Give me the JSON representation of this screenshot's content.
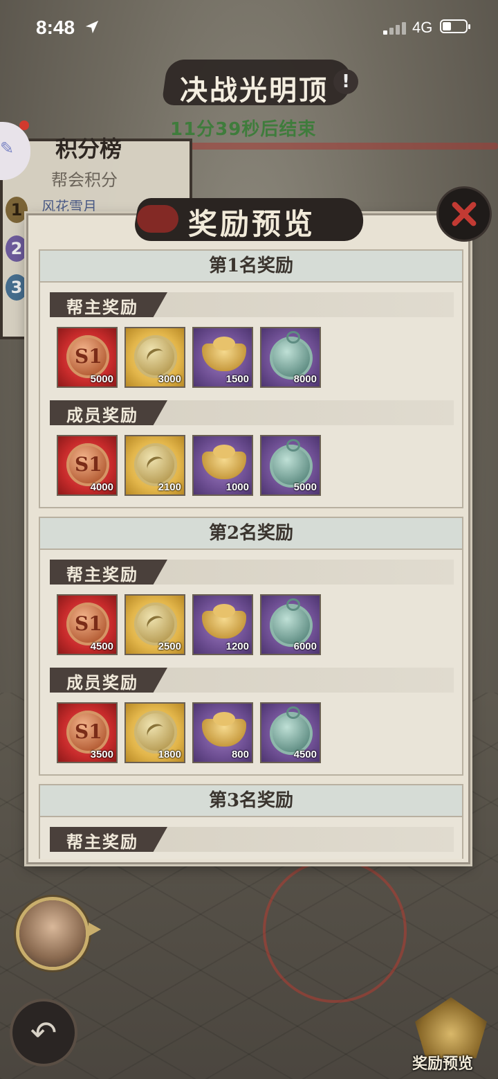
{
  "status_bar": {
    "time": "8:48",
    "network": "4G"
  },
  "event": {
    "title": "决战光明顶",
    "countdown": "11分39秒后结束",
    "alert_symbol": "!"
  },
  "leaderboard": {
    "title": "积分榜",
    "subtitle": "帮会积分",
    "first_name": "风花雪月",
    "ranks": [
      "1",
      "2",
      "3"
    ]
  },
  "modal": {
    "title": "奖励预览",
    "ranks": [
      {
        "heading": "第1名奖励",
        "groups": [
          {
            "label": "帮主奖励",
            "items": [
              {
                "kind": "s1-coin",
                "quantity": "5000"
              },
              {
                "kind": "feather-coin",
                "quantity": "3000"
              },
              {
                "kind": "gold-ingot",
                "quantity": "1500"
              },
              {
                "kind": "jade-medal",
                "quantity": "8000"
              }
            ]
          },
          {
            "label": "成员奖励",
            "items": [
              {
                "kind": "s1-coin",
                "quantity": "4000"
              },
              {
                "kind": "feather-coin",
                "quantity": "2100"
              },
              {
                "kind": "gold-ingot",
                "quantity": "1000"
              },
              {
                "kind": "jade-medal",
                "quantity": "5000"
              }
            ]
          }
        ]
      },
      {
        "heading": "第2名奖励",
        "groups": [
          {
            "label": "帮主奖励",
            "items": [
              {
                "kind": "s1-coin",
                "quantity": "4500"
              },
              {
                "kind": "feather-coin",
                "quantity": "2500"
              },
              {
                "kind": "gold-ingot",
                "quantity": "1200"
              },
              {
                "kind": "jade-medal",
                "quantity": "6000"
              }
            ]
          },
          {
            "label": "成员奖励",
            "items": [
              {
                "kind": "s1-coin",
                "quantity": "3500"
              },
              {
                "kind": "feather-coin",
                "quantity": "1800"
              },
              {
                "kind": "gold-ingot",
                "quantity": "800"
              },
              {
                "kind": "jade-medal",
                "quantity": "4500"
              }
            ]
          }
        ]
      },
      {
        "heading": "第3名奖励",
        "groups": [
          {
            "label": "帮主奖励",
            "items": [
              {
                "kind": "s1-coin",
                "quantity": ""
              },
              {
                "kind": "feather-coin",
                "quantity": ""
              },
              {
                "kind": "gold-ingot",
                "quantity": ""
              },
              {
                "kind": "jade-medal",
                "quantity": ""
              }
            ]
          }
        ]
      }
    ]
  },
  "bottom_right": {
    "label": "奖励预览"
  },
  "colors": {
    "accent_red": "#c23a33",
    "countdown_green": "#3f7c3c",
    "ink": "#2a2421"
  }
}
